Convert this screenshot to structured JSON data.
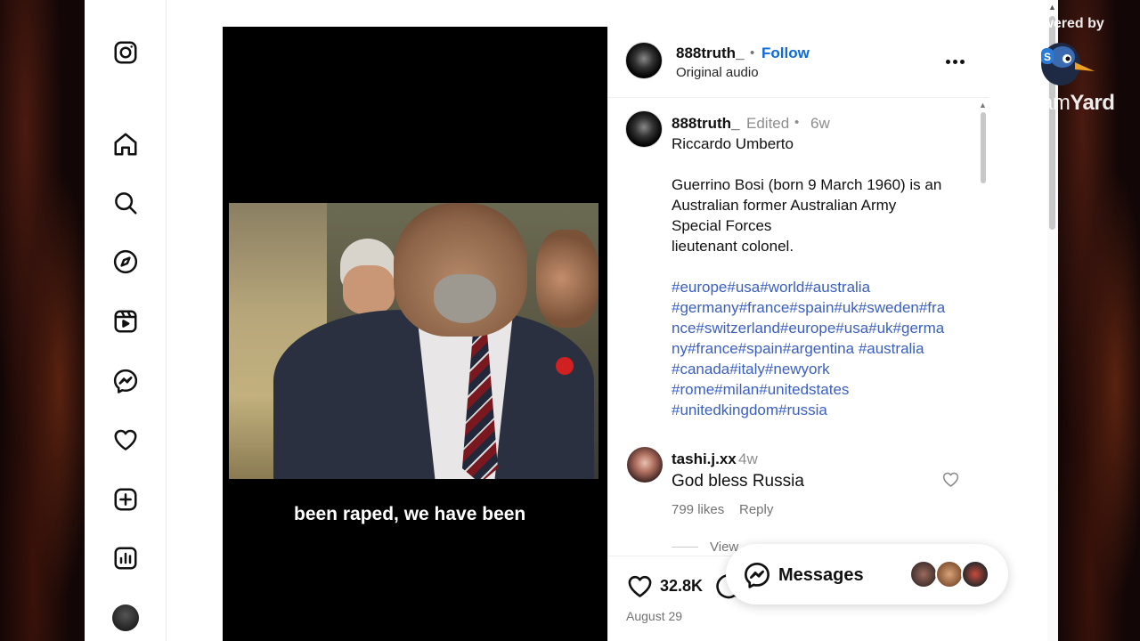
{
  "post": {
    "username": "888truth_",
    "follow_label": "Follow",
    "dot": "•",
    "audio": "Original audio",
    "edited": "Edited",
    "time": "6w",
    "caption_lines": [
      "Riccardo Umberto",
      "Guerrino Bosi (born 9 March 1960) is an",
      "Australian former Australian Army",
      "Special Forces",
      "lieutenant colonel."
    ],
    "hashtag_lines": [
      "#europe#usa#world#australia",
      "#germany#france#spain#uk#sweden#fra",
      "nce#switzerland#europe#usa#uk#germa",
      "ny#france#spain#argentina #australia",
      "#canada#italy#newyork",
      "#rome#milan#unitedstates",
      "#unitedkingdom#russia"
    ],
    "likes": "32.8K",
    "date": "August 29"
  },
  "video": {
    "subtitle": "been raped, we have been"
  },
  "comment": {
    "username": "tashi.j.xx",
    "time": "4w",
    "text": "God bless Russia",
    "likes": "799 likes",
    "reply": "Reply",
    "view_replies": "View"
  },
  "messages": {
    "label": "Messages"
  },
  "overlay": {
    "powered_by": "Powered by",
    "brand_light": "Stream",
    "brand_bold": "Yard"
  },
  "icons": {
    "sidebar": [
      "instagram-icon",
      "home-icon",
      "search-icon",
      "explore-icon",
      "reels-icon",
      "messenger-icon",
      "heart-icon",
      "create-icon",
      "dashboard-icon"
    ]
  },
  "colors": {
    "link_blue": "#0d6ad8",
    "hashtag_blue": "#3b5fbf"
  }
}
